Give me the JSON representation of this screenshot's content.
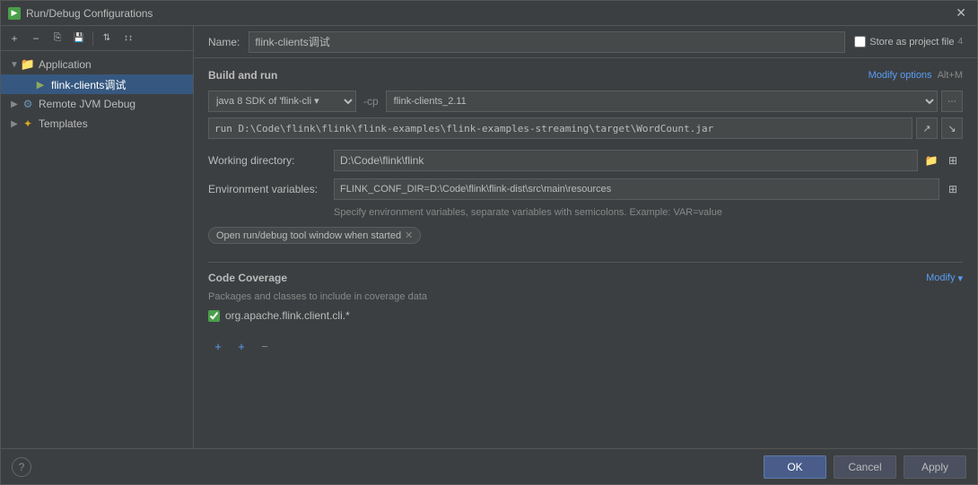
{
  "titlebar": {
    "title": "Run/Debug Configurations",
    "icon": "▶"
  },
  "left_toolbar": {
    "add_label": "+",
    "remove_label": "−",
    "copy_label": "⎘",
    "save_label": "💾",
    "sort_label": "↕",
    "arrows_label": "⇅"
  },
  "tree": {
    "application_label": "Application",
    "flink_config_label": "flink-clients调试",
    "remote_jvm_label": "Remote JVM Debug",
    "templates_label": "Templates"
  },
  "header": {
    "name_label": "Name:",
    "name_value": "flink-clients调试",
    "store_label": "Store as project file",
    "store_number": "4"
  },
  "build_run": {
    "section_title": "Build and run",
    "modify_options_label": "Modify options",
    "modify_shortcut": "Alt+M",
    "sdk_value": "java 8 SDK of 'flink-cli ▾",
    "sdk_options": [
      "java 8 SDK of 'flink-cli'"
    ],
    "dash": "-cp",
    "cp_value": "flink-clients_2.11",
    "cp_options": [
      "flink-clients_2.11"
    ],
    "command": "run D:\\Code\\flink\\flink\\flink-examples\\flink-examples-streaming\\target\\WordCount.jar",
    "expand_icon": "⤢"
  },
  "working_directory": {
    "label": "Working directory:",
    "value": "D:\\Code\\flink\\flink"
  },
  "environment": {
    "label": "Environment variables:",
    "value": "FLINK_CONF_DIR=D:\\Code\\flink\\flink-dist\\src\\main\\resources",
    "hint": "Specify environment variables, separate variables with semicolons. Example: VAR=value"
  },
  "tags": {
    "open_run_debug": "Open run/debug tool window when started"
  },
  "code_coverage": {
    "section_title": "Code Coverage",
    "modify_label": "Modify",
    "desc": "Packages and classes to include in coverage data",
    "checkbox_label": "org.apache.flink.client.cli.*",
    "checked": true
  },
  "bottom_toolbar": {
    "add_btn": "+",
    "add_folder_btn": "+",
    "remove_btn": "−"
  },
  "footer": {
    "help_label": "?",
    "ok_label": "OK",
    "cancel_label": "Cancel",
    "apply_label": "Apply"
  }
}
